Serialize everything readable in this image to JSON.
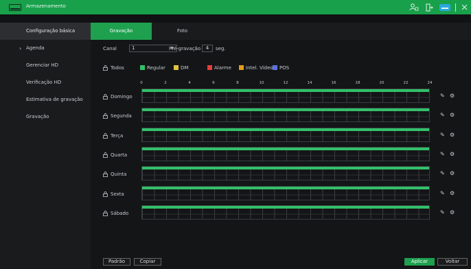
{
  "app": {
    "title": "Armazenamento"
  },
  "sidebar": {
    "items": [
      {
        "label": "Configuração básica"
      },
      {
        "label": "Agenda",
        "arrow": "›"
      },
      {
        "label": "Gerenciar HD"
      },
      {
        "label": "Verificação HD"
      },
      {
        "label": "Estimativa de gravação"
      },
      {
        "label": "Gravação"
      }
    ]
  },
  "tabs": [
    {
      "label": "Gravação"
    },
    {
      "label": "Foto"
    }
  ],
  "form": {
    "canal_label": "Canal",
    "canal_value": "1",
    "prerec_label": "Pré-gravação",
    "prerec_value": "4",
    "prerec_unit": "seg."
  },
  "legend": {
    "all_label": "Todos",
    "items": [
      {
        "label": "Regular",
        "color": "#32c06a"
      },
      {
        "label": "DM",
        "color": "#e3c341"
      },
      {
        "label": "Alarme",
        "color": "#e0403c"
      },
      {
        "label": "Intel. Vídeo",
        "color": "#e39a1e"
      },
      {
        "label": "POS",
        "color": "#5b6fe0"
      }
    ]
  },
  "ruler": {
    "ticks": [
      "0",
      "2",
      "4",
      "6",
      "8",
      "10",
      "12",
      "14",
      "16",
      "18",
      "20",
      "22",
      "24"
    ]
  },
  "days": [
    {
      "label": "Domingo",
      "regular_fraction": 1.0
    },
    {
      "label": "Segunda",
      "regular_fraction": 1.0
    },
    {
      "label": "Terça",
      "regular_fraction": 1.0
    },
    {
      "label": "Quarta",
      "regular_fraction": 1.0
    },
    {
      "label": "Quinta",
      "regular_fraction": 1.0
    },
    {
      "label": "Sexta",
      "regular_fraction": 1.0
    },
    {
      "label": "Sábado",
      "regular_fraction": 1.0
    }
  ],
  "buttons": {
    "default": "Padrão",
    "copy": "Copiar",
    "apply": "Aplicar",
    "back": "Voltar"
  },
  "colors": {
    "accent": "#1ea04f",
    "regular": "#32c06a"
  }
}
